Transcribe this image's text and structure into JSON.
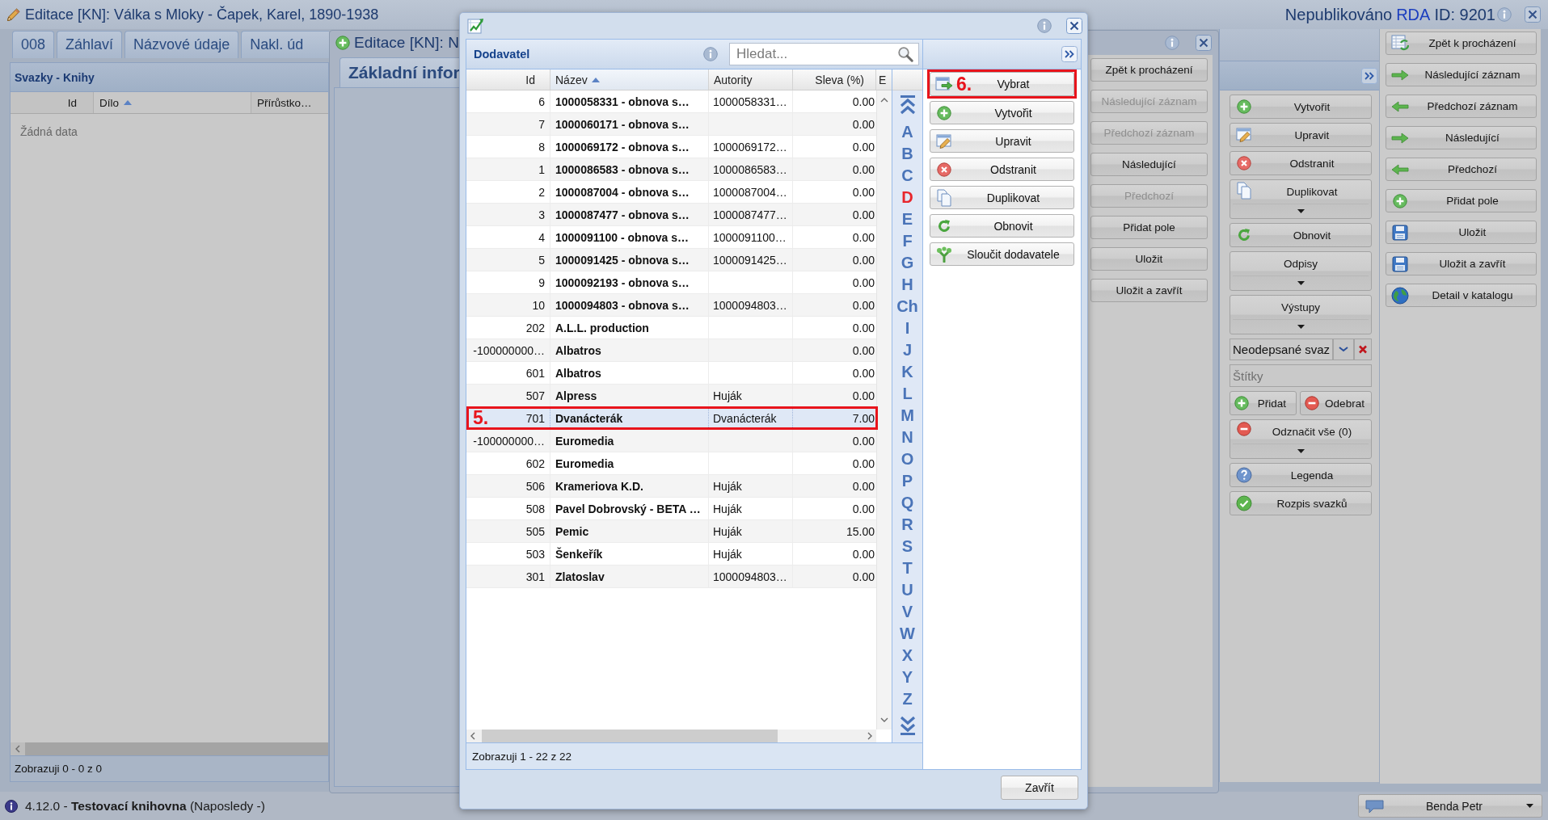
{
  "main_window": {
    "title": "Editace [KN]: Válka s Mloky - Čapek, Karel, 1890-1938",
    "publication_status": "Nepublikováno",
    "format": "RDA",
    "record_id": "ID: 9201",
    "tabs": [
      {
        "label": "008",
        "selected": false
      },
      {
        "label": "Záhlaví",
        "selected": false
      },
      {
        "label": "Názvové údaje",
        "selected": false
      },
      {
        "label": "Nakl. úd",
        "selected": false
      }
    ],
    "volumes_panel": {
      "title": "Svazky - Knihy",
      "columns": [
        {
          "label": "Id",
          "sorted": false
        },
        {
          "label": "Dílo",
          "sorted": true
        },
        {
          "label": "Přírůstko…",
          "sorted": false
        }
      ],
      "empty_text": "Žádná data",
      "paging": "Zobrazuji 0 - 0 z 0"
    },
    "volume_actions": [
      {
        "kind": "button",
        "label": "Vytvořit"
      },
      {
        "kind": "button",
        "label": "Upravit"
      },
      {
        "kind": "button",
        "label": "Odstranit"
      },
      {
        "kind": "split",
        "label": "Duplikovat"
      },
      {
        "kind": "button",
        "label": "Obnovit"
      },
      {
        "kind": "split",
        "label": "Odpisy"
      },
      {
        "kind": "split",
        "label": "Výstupy"
      },
      {
        "kind": "combo",
        "value": "Neodepsané svaz"
      },
      {
        "kind": "field",
        "placeholder": "Štítky"
      },
      {
        "kind": "pair",
        "buttons": [
          {
            "label": "Přidat"
          },
          {
            "label": "Odebrat"
          }
        ]
      },
      {
        "kind": "split",
        "label": "Odznačit vše (0)"
      },
      {
        "kind": "button",
        "label": "Legenda"
      },
      {
        "kind": "button",
        "label": "Rozpis svazků"
      }
    ],
    "record_actions": [
      {
        "label": "Zpět k procházení"
      },
      {
        "label": "Následující záznam"
      },
      {
        "label": "Předchozí záznam"
      },
      {
        "label": "Následující"
      },
      {
        "label": "Předchozí"
      },
      {
        "label": "Přidat pole"
      },
      {
        "label": "Uložit"
      },
      {
        "label": "Uložit a zavřít"
      },
      {
        "label": "Detail v katalogu"
      }
    ]
  },
  "editor_window": {
    "title": "Editace [KN]: N",
    "tabs": [
      {
        "label": "Základní infor",
        "selected": true
      }
    ],
    "actions": [
      {
        "label": "Zpět k procházení",
        "disabled": false
      },
      {
        "label": "Následující záznam",
        "disabled": true
      },
      {
        "label": "Předchozí záznam",
        "disabled": true
      },
      {
        "label": "Následující",
        "disabled": false
      },
      {
        "label": "Předchozí",
        "disabled": true
      },
      {
        "label": "Přidat pole",
        "disabled": false
      },
      {
        "label": "Uložit",
        "disabled": false
      },
      {
        "label": "Uložit a zavřít",
        "disabled": false
      }
    ]
  },
  "supplier_dialog": {
    "panel_title": "Dodavatel",
    "search": {
      "placeholder": "Hledat..."
    },
    "table": {
      "columns": [
        {
          "label": "Id",
          "sorted": false
        },
        {
          "label": "Název",
          "sorted": true
        },
        {
          "label": "Autority",
          "sorted": false
        },
        {
          "label": "Sleva (%)",
          "sorted": false
        },
        {
          "label": "E",
          "sorted": false
        }
      ],
      "rows": [
        {
          "id": "6",
          "name": "1000058331 - obnova s…",
          "authorities": "1000058331…",
          "discount": "0.00",
          "selected": false
        },
        {
          "id": "7",
          "name": "1000060171 - obnova s…",
          "discount": "0.00",
          "selected": false
        },
        {
          "id": "8",
          "name": "1000069172 - obnova s…",
          "authorities": "1000069172…",
          "discount": "0.00",
          "selected": false
        },
        {
          "id": "1",
          "name": "1000086583 - obnova s…",
          "authorities": "1000086583…",
          "discount": "0.00",
          "selected": false
        },
        {
          "id": "2",
          "name": "1000087004 - obnova s…",
          "authorities": "1000087004…",
          "discount": "0.00",
          "selected": false
        },
        {
          "id": "3",
          "name": "1000087477 - obnova s…",
          "authorities": "1000087477…",
          "discount": "0.00",
          "selected": false
        },
        {
          "id": "4",
          "name": "1000091100 - obnova s…",
          "authorities": "1000091100…",
          "discount": "0.00",
          "selected": false
        },
        {
          "id": "5",
          "name": "1000091425 - obnova s…",
          "authorities": "1000091425…",
          "discount": "0.00",
          "selected": false
        },
        {
          "id": "9",
          "name": "1000092193 - obnova s…",
          "discount": "0.00",
          "selected": false
        },
        {
          "id": "10",
          "name": "1000094803 - obnova s…",
          "authorities": "1000094803…",
          "discount": "0.00",
          "selected": false
        },
        {
          "id": "202",
          "name": "A.L.L. production",
          "discount": "0.00",
          "selected": false
        },
        {
          "id": "-100000000…",
          "name": "Albatros",
          "discount": "0.00",
          "selected": false
        },
        {
          "id": "601",
          "name": "Albatros",
          "discount": "0.00",
          "selected": false
        },
        {
          "id": "507",
          "name": "Alpress",
          "authorities": "Huják",
          "discount": "0.00",
          "selected": false
        },
        {
          "id": "701",
          "name": "Dvanácterák",
          "authorities": "Dvanácterák",
          "discount": "7.00",
          "selected": true,
          "callout": "5."
        },
        {
          "id": "-100000000…",
          "name": "Euromedia",
          "discount": "0.00",
          "selected": false
        },
        {
          "id": "602",
          "name": "Euromedia",
          "discount": "0.00",
          "selected": false
        },
        {
          "id": "506",
          "name": "Krameriova K.D.",
          "authorities": "Huják",
          "discount": "0.00",
          "selected": false
        },
        {
          "id": "508",
          "name": "Pavel Dobrovský - BETA …",
          "authorities": "Huják",
          "discount": "0.00",
          "selected": false
        },
        {
          "id": "505",
          "name": "Pemic",
          "authorities": "Huják",
          "discount": "15.00",
          "selected": false
        },
        {
          "id": "503",
          "name": "Šenkeřík",
          "authorities": "Huják",
          "discount": "0.00",
          "selected": false
        },
        {
          "id": "301",
          "name": "Zlatoslav",
          "authorities": "1000094803…",
          "discount": "0.00",
          "selected": false
        }
      ]
    },
    "index_letters": [
      {
        "letter": "A",
        "active": false
      },
      {
        "letter": "B",
        "active": false
      },
      {
        "letter": "C",
        "active": false
      },
      {
        "letter": "D",
        "active": true
      },
      {
        "letter": "E",
        "active": false
      },
      {
        "letter": "F",
        "active": false
      },
      {
        "letter": "G",
        "active": false
      },
      {
        "letter": "H",
        "active": false
      },
      {
        "letter": "Ch",
        "active": false
      },
      {
        "letter": "I",
        "active": false
      },
      {
        "letter": "J",
        "active": false
      },
      {
        "letter": "K",
        "active": false
      },
      {
        "letter": "L",
        "active": false
      },
      {
        "letter": "M",
        "active": false
      },
      {
        "letter": "N",
        "active": false
      },
      {
        "letter": "O",
        "active": false
      },
      {
        "letter": "P",
        "active": false
      },
      {
        "letter": "Q",
        "active": false
      },
      {
        "letter": "R",
        "active": false
      },
      {
        "letter": "S",
        "active": false
      },
      {
        "letter": "T",
        "active": false
      },
      {
        "letter": "U",
        "active": false
      },
      {
        "letter": "V",
        "active": false
      },
      {
        "letter": "W",
        "active": false
      },
      {
        "letter": "X",
        "active": false
      },
      {
        "letter": "Y",
        "active": false
      },
      {
        "letter": "Z",
        "active": false
      }
    ],
    "paging": "Zobrazuji 1 - 22 z 22",
    "actions": [
      {
        "label": "Vybrat",
        "callout": "6."
      },
      {
        "label": "Vytvořit"
      },
      {
        "label": "Upravit"
      },
      {
        "label": "Odstranit"
      },
      {
        "label": "Duplikovat"
      },
      {
        "label": "Obnovit"
      },
      {
        "label": "Sloučit dodavatele"
      }
    ],
    "close_button": "Zavřít"
  },
  "status_bar": {
    "version_line": "4.12.0 - **Testovací knihovna** (Naposledy -)",
    "user": "Benda Petr"
  }
}
